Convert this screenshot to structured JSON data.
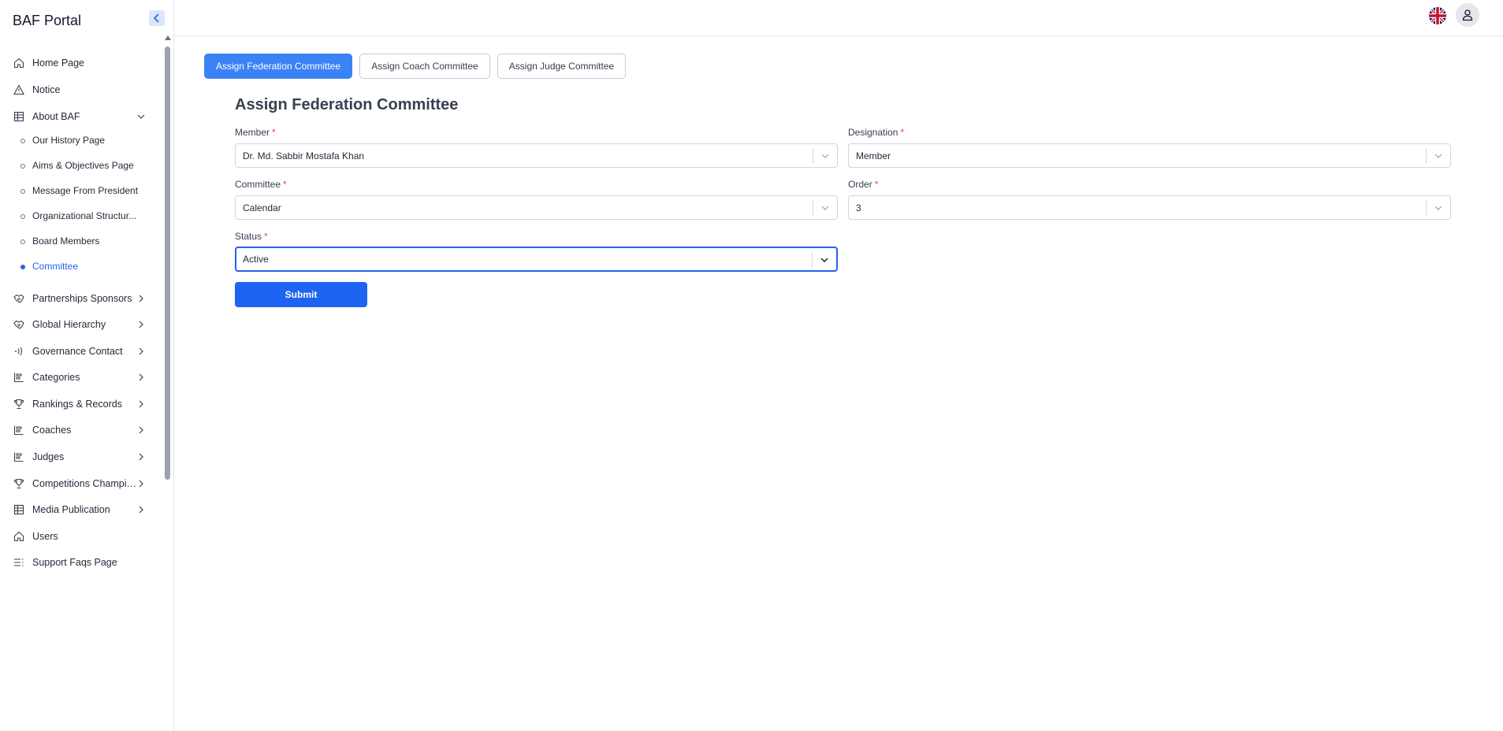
{
  "app": {
    "title": "BAF Portal"
  },
  "sidebar": {
    "items": [
      {
        "label": "Home Page",
        "icon": "home-icon"
      },
      {
        "label": "Notice",
        "icon": "warning-icon"
      },
      {
        "label": "About BAF",
        "icon": "table-icon",
        "expanded": true,
        "children": [
          {
            "label": "Our History Page"
          },
          {
            "label": "Aims & Objectives Page"
          },
          {
            "label": "Message From President"
          },
          {
            "label": "Organizational Structur..."
          },
          {
            "label": "Board Members"
          },
          {
            "label": "Committee",
            "active": true
          }
        ]
      },
      {
        "label": "Partnerships Sponsors",
        "icon": "handshake-icon"
      },
      {
        "label": "Global Hierarchy",
        "icon": "handshake-icon"
      },
      {
        "label": "Governance Contact",
        "icon": "signal-icon"
      },
      {
        "label": "Categories",
        "icon": "chart-icon"
      },
      {
        "label": "Rankings & Records",
        "icon": "trophy-icon"
      },
      {
        "label": "Coaches",
        "icon": "chart-icon"
      },
      {
        "label": "Judges",
        "icon": "chart-icon"
      },
      {
        "label": "Competitions Champio...",
        "icon": "trophy-icon"
      },
      {
        "label": "Media Publication",
        "icon": "table-icon"
      },
      {
        "label": "Users",
        "icon": "home-icon"
      },
      {
        "label": "Support Faqs Page",
        "icon": "list-icon"
      }
    ]
  },
  "tabs": [
    {
      "label": "Assign Federation Committee",
      "active": true
    },
    {
      "label": "Assign Coach Committee",
      "active": false
    },
    {
      "label": "Assign Judge Committee",
      "active": false
    }
  ],
  "form": {
    "title": "Assign Federation Committee",
    "required_mark": "*",
    "member": {
      "label": "Member",
      "value": "Dr. Md. Sabbir Mostafa Khan"
    },
    "designation": {
      "label": "Designation",
      "value": "Member"
    },
    "committee": {
      "label": "Committee",
      "value": "Calendar"
    },
    "order": {
      "label": "Order",
      "value": "3"
    },
    "status": {
      "label": "Status",
      "value": "Active"
    },
    "submit_label": "Submit"
  },
  "colors": {
    "primary": "#1d64f2",
    "tab_active": "#3b82f6",
    "required": "#ef4444"
  }
}
